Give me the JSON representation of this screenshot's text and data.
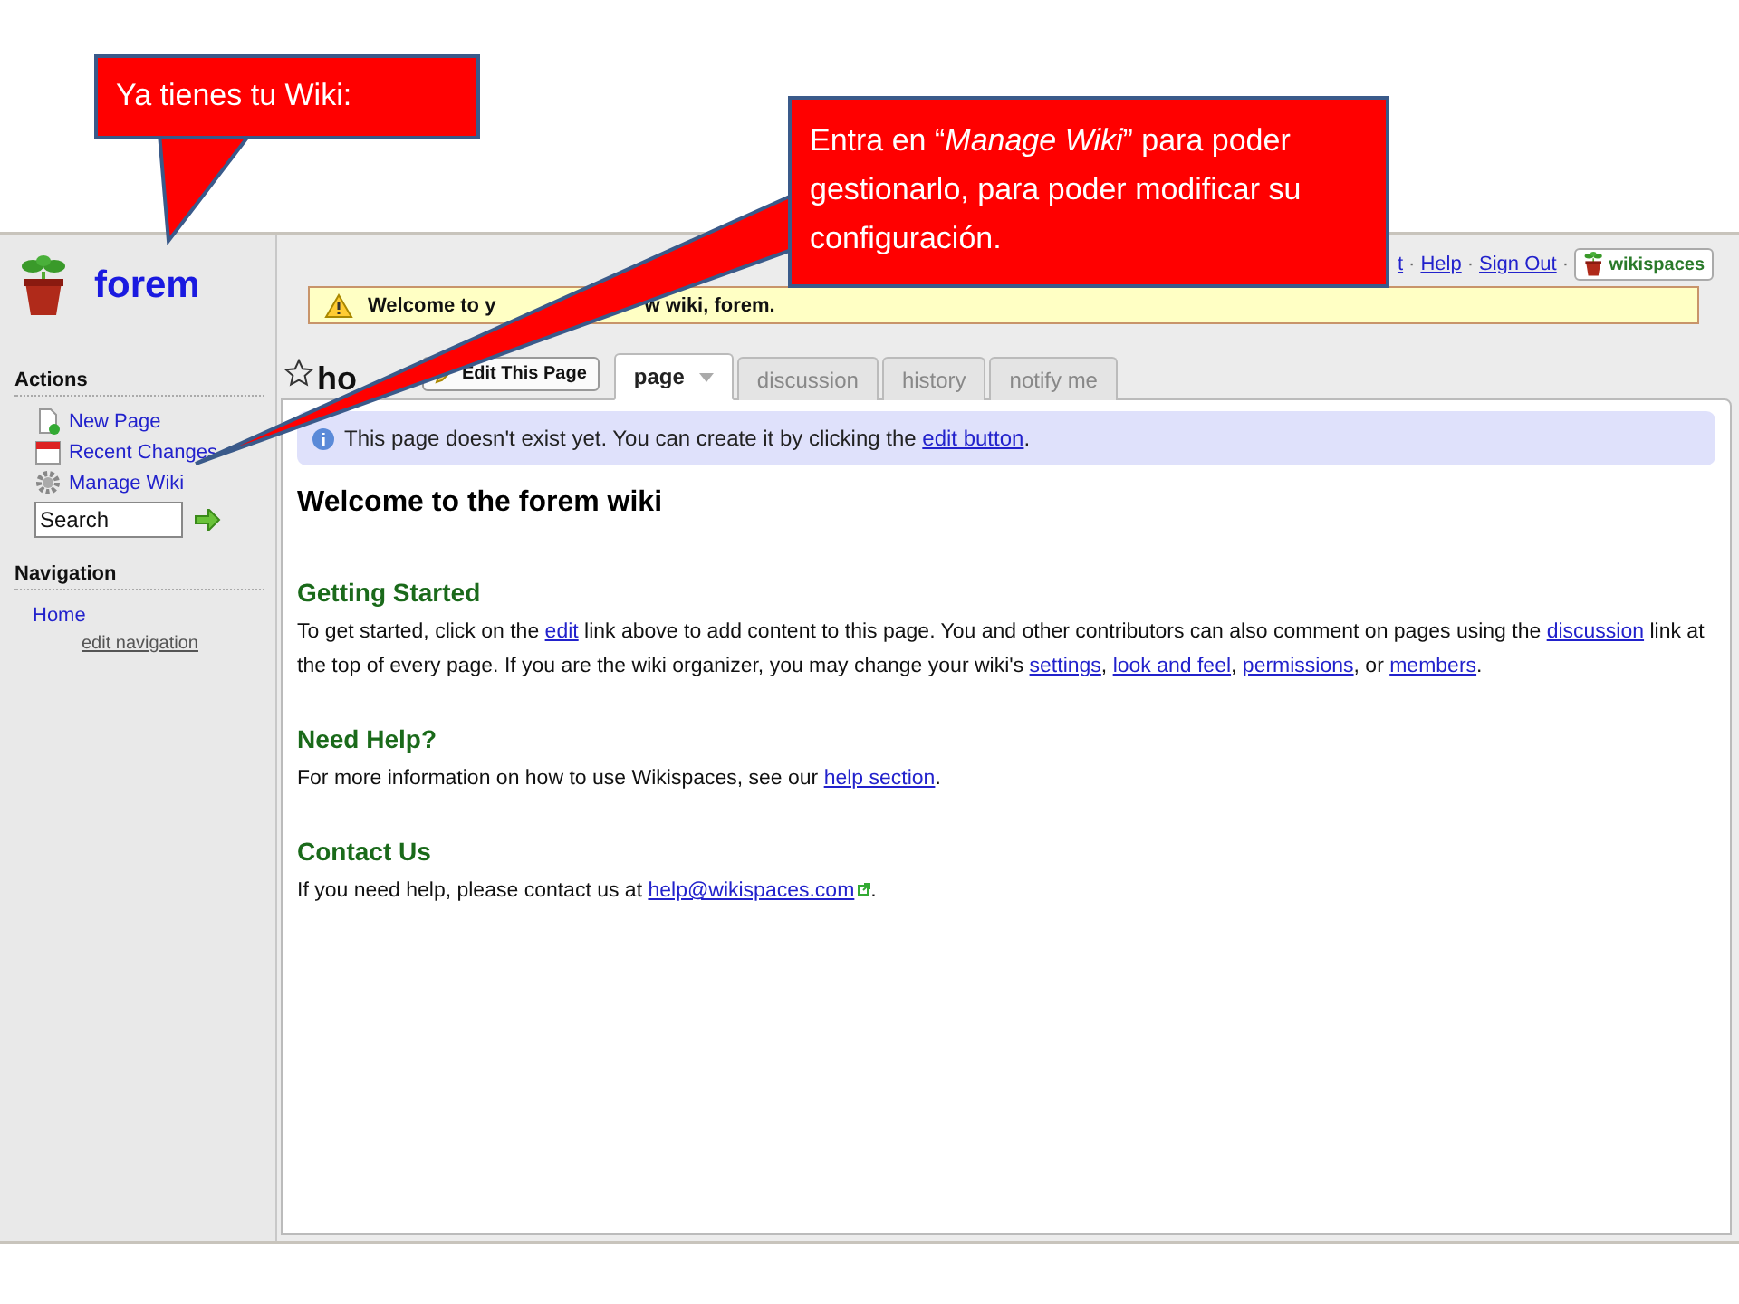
{
  "callouts": [
    {
      "text": "Ya tienes tu Wiki:"
    },
    {
      "text": "Entra en “*Manage Wiki*” para poder gestionarlo, para poder modificar su configuración."
    }
  ],
  "sidebar": {
    "site_name": "forem",
    "sections": [
      {
        "title": "Actions",
        "items": [
          {
            "label": "New Page",
            "kind": "new-page"
          },
          {
            "label": "Recent Changes",
            "kind": "calendar"
          },
          {
            "label": "Manage Wiki",
            "kind": "gear"
          }
        ]
      },
      {
        "title": "Navigation",
        "items": [
          {
            "label": "Home",
            "kind": "plain"
          }
        ]
      }
    ],
    "search": {
      "value": "Search"
    },
    "edit_navigation": "edit navigation"
  },
  "top_links": [
    "t",
    "Help",
    "Sign Out"
  ],
  "link_separator": "·",
  "brand_badge": "wikispaces",
  "banner": {
    "parts": [
      "Welcome to y",
      "w wiki, forem."
    ]
  },
  "page_title": "ho",
  "edit_button": "Edit This Page",
  "tabs": [
    {
      "label": "page",
      "selected": true,
      "dropdown": true
    },
    {
      "label": "discussion",
      "selected": false,
      "dropdown": false
    },
    {
      "label": "history",
      "selected": false,
      "dropdown": false
    },
    {
      "label": "notify me",
      "selected": false,
      "dropdown": false
    }
  ],
  "notice": [
    {
      "kind": "text",
      "text": "This page doesn't exist yet. You can create it by clicking the "
    },
    {
      "kind": "link",
      "text": "edit button"
    },
    {
      "kind": "text",
      "text": "."
    }
  ],
  "content": {
    "title": "Welcome to the forem wiki",
    "sections": [
      {
        "heading": "Getting Started",
        "paragraph": [
          {
            "kind": "text",
            "text": "To get started, click on the "
          },
          {
            "kind": "link",
            "text": "edit"
          },
          {
            "kind": "text",
            "text": " link above to add content to this page. You and other contributors can also comment on pages using the "
          },
          {
            "kind": "link",
            "text": "discussion"
          },
          {
            "kind": "text",
            "text": " link at the top of every page. If you are the wiki organizer, you may change your wiki's "
          },
          {
            "kind": "link",
            "text": "settings"
          },
          {
            "kind": "text",
            "text": ", "
          },
          {
            "kind": "link",
            "text": "look and feel"
          },
          {
            "kind": "text",
            "text": ", "
          },
          {
            "kind": "link",
            "text": "permissions"
          },
          {
            "kind": "text",
            "text": ", or "
          },
          {
            "kind": "link",
            "text": "members"
          },
          {
            "kind": "text",
            "text": "."
          }
        ]
      },
      {
        "heading": "Need Help?",
        "paragraph": [
          {
            "kind": "text",
            "text": "For more information on how to use Wikispaces, see our "
          },
          {
            "kind": "link",
            "text": "help section"
          },
          {
            "kind": "text",
            "text": "."
          }
        ]
      },
      {
        "heading": "Contact Us",
        "paragraph": [
          {
            "kind": "text",
            "text": "If you need help, please contact us at "
          },
          {
            "kind": "extlink",
            "text": "help@wikispaces.com"
          },
          {
            "kind": "text",
            "text": "."
          }
        ]
      }
    ]
  }
}
